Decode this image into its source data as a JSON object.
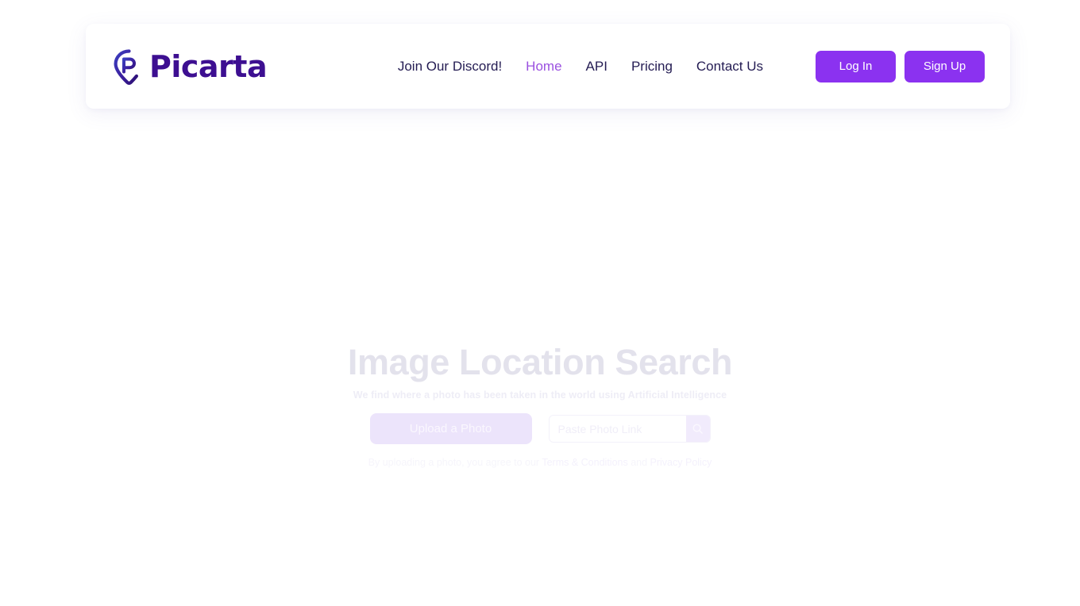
{
  "brand": {
    "name": "Picarta",
    "logo_icon": "map-pin-p-icon",
    "wordmark_color": "#3d0f91"
  },
  "header": {
    "nav": [
      {
        "label": "Join Our Discord!",
        "active": false
      },
      {
        "label": "Home",
        "active": true
      },
      {
        "label": "API",
        "active": false
      },
      {
        "label": "Pricing",
        "active": false
      },
      {
        "label": "Contact Us",
        "active": false
      }
    ],
    "auth": {
      "login_label": "Log In",
      "signup_label": "Sign Up",
      "button_color": "#8b32f0",
      "active_link_color": "#9b51e0"
    }
  },
  "hero": {
    "title": "Image Location Search",
    "subtitle": "We find where a photo has been taken in the world using Artificial Intelligence",
    "upload_label": "Upload a Photo",
    "link_placeholder": "Paste Photo Link",
    "link_value": "",
    "search_icon": "search-icon",
    "terms": {
      "prefix": "By uploading a photo, you agree to our ",
      "terms_link": "Terms & Conditions",
      "middle": " and ",
      "privacy_link": "Privacy Policy"
    }
  }
}
